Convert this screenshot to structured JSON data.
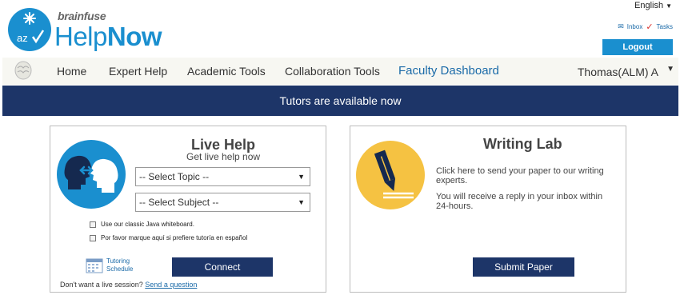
{
  "brand": {
    "small": "brainfuse",
    "help": "Help",
    "now": "Now"
  },
  "header": {
    "language": "English",
    "inbox": "Inbox",
    "tasks": "Tasks",
    "logout": "Logout"
  },
  "nav": {
    "items": [
      "Home",
      "Expert Help",
      "Academic Tools",
      "Collaboration Tools",
      "Faculty Dashboard"
    ],
    "user": "Thomas(ALM) A"
  },
  "banner": "Tutors are available now",
  "live_help": {
    "title": "Live Help",
    "subtitle": "Get live help now",
    "topic_select": "-- Select Topic --",
    "subject_select": "-- Select Subject --",
    "checkbox_java": "Use our classic Java whiteboard.",
    "checkbox_spanish": "Por favor marque aquí si prefiere tutoría en español",
    "schedule_line1": "Tutoring",
    "schedule_line2": "Schedule",
    "connect": "Connect",
    "no_live_text": "Don't want a live session?",
    "send_question": "Send a question"
  },
  "writing_lab": {
    "title": "Writing Lab",
    "text1": "Click here to send your paper to our writing experts.",
    "text2": "You will receive a reply in your inbox within 24-hours.",
    "submit": "Submit Paper"
  },
  "colors": {
    "brand_blue": "#1a8fcf",
    "navy": "#1d3568",
    "accent_yellow": "#f5c242"
  }
}
